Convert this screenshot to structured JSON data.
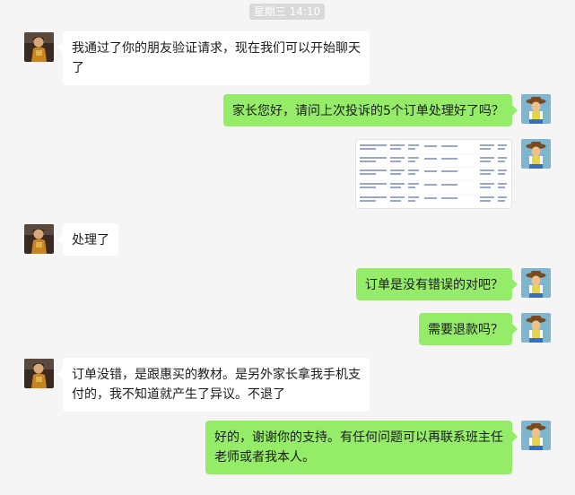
{
  "chat": {
    "timestamp": "星期三 14:10",
    "messages": [
      {
        "side": "in",
        "type": "text",
        "text": "我通过了你的朋友验证请求，现在我们可以开始聊天了"
      },
      {
        "side": "out",
        "type": "text",
        "text": "家长您好，请问上次投诉的5个订单处理好了吗？"
      },
      {
        "side": "out",
        "type": "image",
        "text": ""
      },
      {
        "side": "in",
        "type": "text",
        "text": "处理了"
      },
      {
        "side": "out",
        "type": "text",
        "text": "订单是没有错误的对吧？"
      },
      {
        "side": "out",
        "type": "text",
        "text": "需要退款吗？"
      },
      {
        "side": "in",
        "type": "text",
        "text": "订单没错，是跟惠买的教材。是另外家长拿我手机支付的，我不知道就产生了异议。不退了"
      },
      {
        "side": "out",
        "type": "text",
        "text": "好的，谢谢你的支持。有任何问题可以再联系班主任老师或者我本人。"
      }
    ]
  },
  "colors": {
    "background": "#f5f5f5",
    "incoming_bubble": "#ffffff",
    "outgoing_bubble": "#95ec69",
    "timestamp_bg": "#d9d9d9"
  },
  "icons": {
    "contact_avatar": "child-photo-avatar",
    "self_avatar": "cartoon-cowboy-avatar"
  }
}
